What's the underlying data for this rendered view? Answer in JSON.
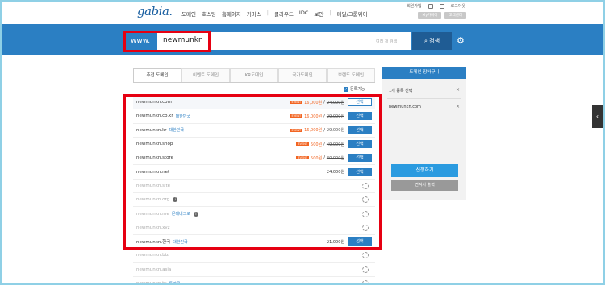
{
  "header": {
    "logo": "gabia.",
    "nav": [
      "도메인",
      "호스팅",
      "홈페이지",
      "커머스",
      "|",
      "클라우드",
      "IDC",
      "보안",
      "|",
      "메일/그룹웨어"
    ],
    "util": {
      "signup": "회원가입",
      "login": "로그아웃"
    },
    "util_buttons": [
      "My가비아",
      "고객센터"
    ]
  },
  "search": {
    "prefix": "www.",
    "value": "newmunkn",
    "placeholder": "여러 개 검색",
    "button": "검색"
  },
  "tabs": [
    "추천 도메인",
    "이벤트 도메인",
    "KR도메인",
    "국가도메인",
    "브랜드 도메인"
  ],
  "register_check_label": "등록기능",
  "results": [
    {
      "domain": "newmunkn.com",
      "tag": "",
      "event": "EVENT",
      "price": "16,000원",
      "orig": "24,000원",
      "action": "선택",
      "state": "selected"
    },
    {
      "domain": "newmunkn.co.kr",
      "tag": "대한민국",
      "event": "EVENT",
      "price": "16,000원",
      "orig": "29,000원",
      "action": "선택",
      "state": "available"
    },
    {
      "domain": "newmunkn.kr",
      "tag": "대한민국",
      "event": "EVENT",
      "price": "16,000원",
      "orig": "29,000원",
      "action": "선택",
      "state": "available"
    },
    {
      "domain": "newmunkn.shop",
      "tag": "",
      "event": "EVENT",
      "price": "500원",
      "orig": "49,000원",
      "action": "선택",
      "state": "available"
    },
    {
      "domain": "newmunkn.store",
      "tag": "",
      "event": "EVENT",
      "price": "500원",
      "orig": "80,000원",
      "action": "선택",
      "state": "available"
    },
    {
      "domain": "newmunkn.net",
      "tag": "",
      "event": "",
      "price": "24,000원",
      "orig": "",
      "action": "선택",
      "state": "available"
    },
    {
      "domain": "newmunkn.site",
      "tag": "",
      "event": "",
      "price": "",
      "orig": "",
      "action": "",
      "state": "loading"
    },
    {
      "domain": "newmunkn.org",
      "tag": "",
      "info": "i",
      "event": "",
      "price": "",
      "orig": "",
      "action": "",
      "state": "loading"
    },
    {
      "domain": "newmunkn.me",
      "tag": "몬테네그로",
      "info": "i",
      "event": "",
      "price": "",
      "orig": "",
      "action": "",
      "state": "loading"
    },
    {
      "domain": "newmunkn.xyz",
      "tag": "",
      "event": "",
      "price": "",
      "orig": "",
      "action": "",
      "state": "loading"
    },
    {
      "domain": "newmunkn.한국",
      "tag": "대한민국",
      "event": "",
      "price": "21,000원",
      "orig": "",
      "action": "선택",
      "state": "available"
    },
    {
      "domain": "newmunkn.biz",
      "tag": "",
      "event": "",
      "price": "",
      "orig": "",
      "action": "",
      "state": "loading"
    },
    {
      "domain": "newmunkn.asia",
      "tag": "",
      "event": "",
      "price": "",
      "orig": "",
      "action": "",
      "state": "loading"
    },
    {
      "domain": "newmunkn.tv",
      "tag": "투발루",
      "event": "",
      "price": "",
      "orig": "",
      "action": "",
      "state": "loading"
    }
  ],
  "cart": {
    "title": "도메인 장바구니",
    "count_label": "1개 등록 선택",
    "item": "newmunkn.com",
    "apply": "신청하기",
    "quote": "견적서 출력"
  },
  "colors": {
    "brand": "#2b7fc3",
    "highlight": "#e60012",
    "event": "#f26522"
  }
}
